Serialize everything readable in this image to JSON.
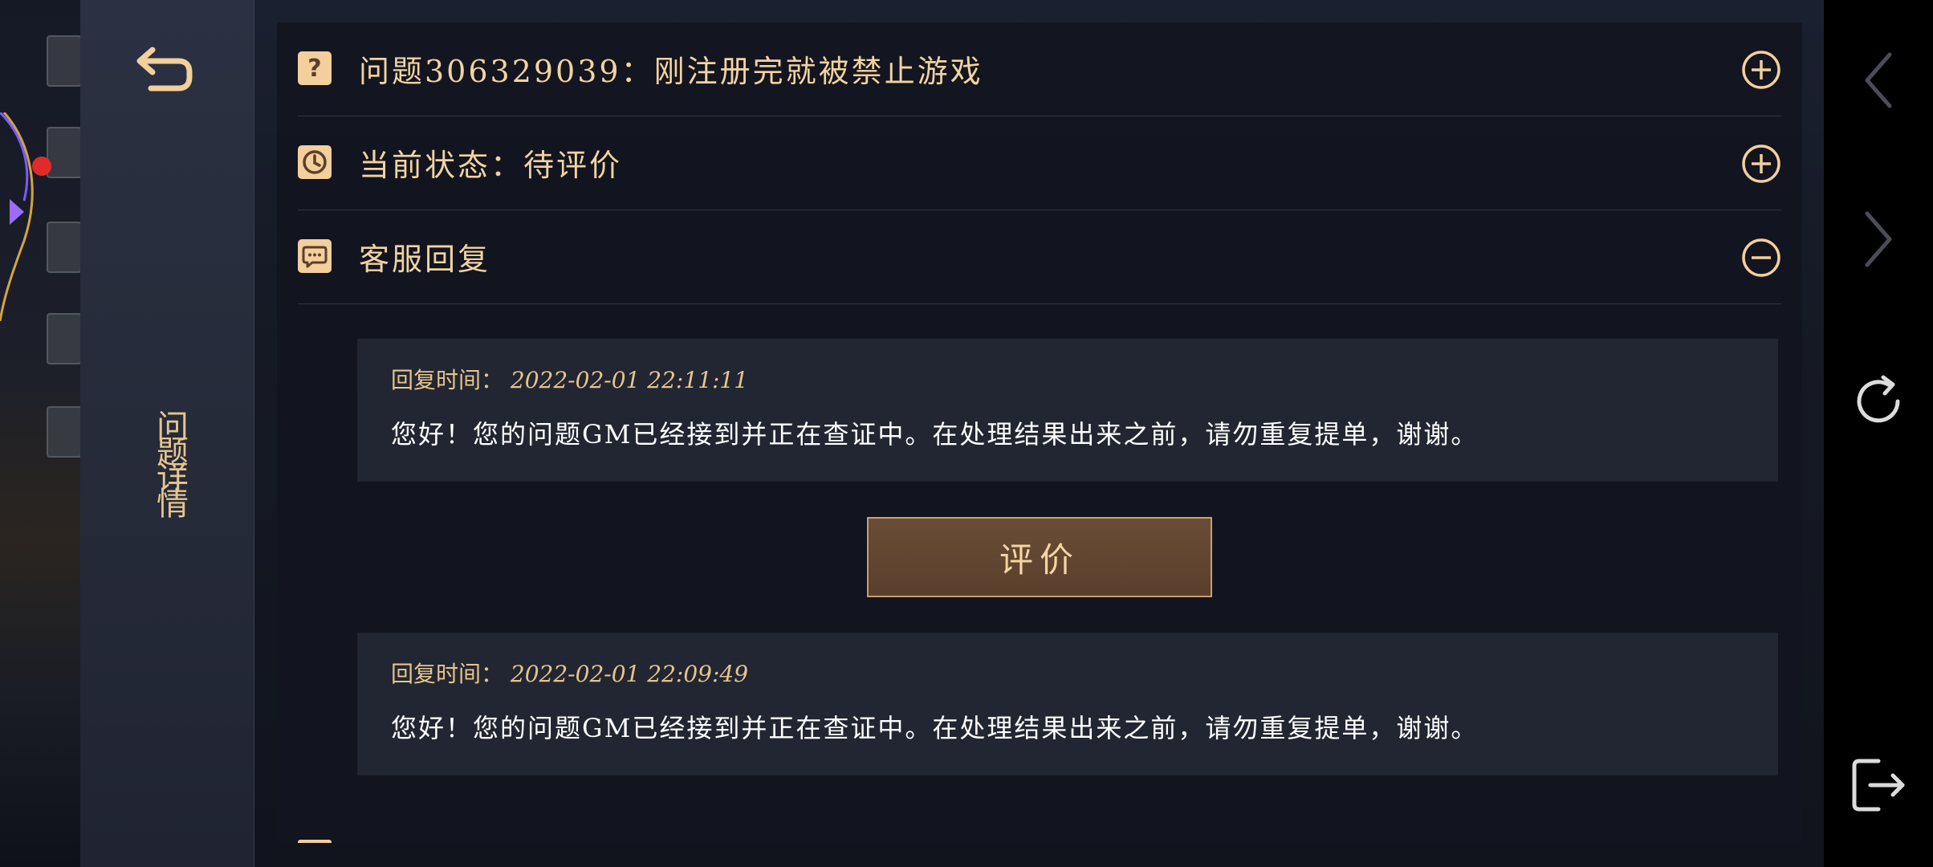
{
  "side_panel": {
    "title": "问题详情"
  },
  "rows": {
    "question": {
      "icon_char": "?",
      "text": "问题306329039：刚注册完就被禁止游戏"
    },
    "status": {
      "text": "当前状态：待评价"
    },
    "reply_header": {
      "text": "客服回复"
    }
  },
  "replies": [
    {
      "time_label": "回复时间：",
      "time_value": "2022-02-01 22:11:11",
      "message": "您好！您的问题GM已经接到并正在查证中。在处理结果出来之前，请勿重复提单，谢谢。"
    },
    {
      "time_label": "回复时间：",
      "time_value": "2022-02-01 22:09:49",
      "message": "您好！您的问题GM已经接到并正在查证中。在处理结果出来之前，请勿重复提单，谢谢。"
    }
  ],
  "rate_button": {
    "label": "评价"
  },
  "icons": {
    "back": "back-arrow-icon",
    "question": "question-mark-icon",
    "clock": "clock-icon",
    "chat": "chat-bubble-icon",
    "expand": "plus-circle-icon",
    "collapse": "minus-circle-icon",
    "nav_back": "chevron-left-icon",
    "nav_forward": "chevron-right-icon",
    "refresh": "refresh-icon",
    "exit": "exit-icon"
  },
  "colors": {
    "accent_gold": "#f2d3a0",
    "icon_bg": "#f3cf9b",
    "button_brown": "#5a3f2c",
    "panel_bg": "#12151f"
  }
}
